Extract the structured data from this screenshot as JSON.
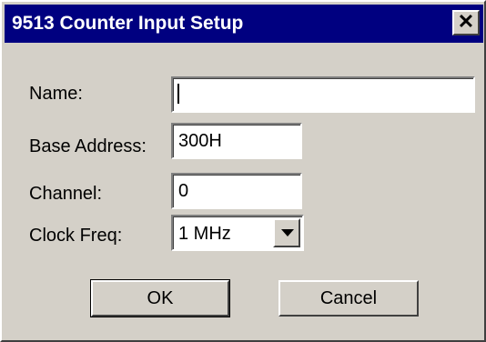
{
  "window": {
    "title": "9513 Counter Input Setup",
    "close_label": "✕"
  },
  "form": {
    "name_label": "Name:",
    "name_value": "",
    "base_address_label": "Base Address:",
    "base_address_value": "300H",
    "channel_label": "Channel:",
    "channel_value": "0",
    "clock_freq_label": "Clock Freq:",
    "clock_freq_value": "1 MHz"
  },
  "buttons": {
    "ok_label": "OK",
    "cancel_label": "Cancel"
  },
  "colors": {
    "title_bar": "#000080",
    "dialog_face": "#d4d0c8",
    "field_background": "#ffffff"
  },
  "icons": {
    "close": "close-icon",
    "dropdown": "chevron-down-icon"
  }
}
